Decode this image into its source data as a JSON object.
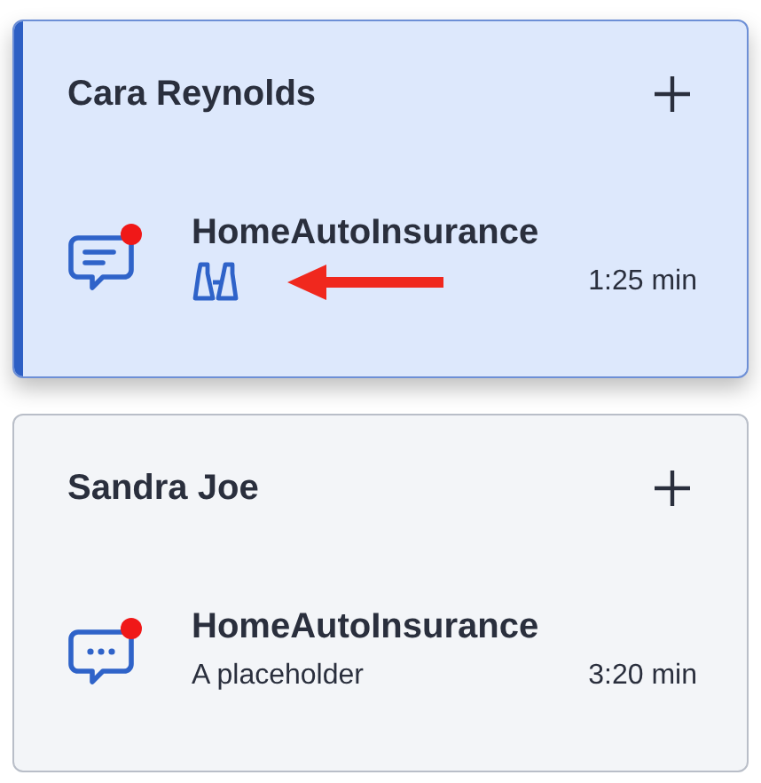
{
  "cards": [
    {
      "name": "Cara Reynolds",
      "selected": true,
      "kind": "watching",
      "unread": true,
      "title": "HomeAutoInsurance",
      "duration": "1:25 min"
    },
    {
      "name": "Sandra Joe",
      "selected": false,
      "kind": "text",
      "unread": true,
      "title": "HomeAutoInsurance",
      "subtitle": "A placeholder",
      "duration": "3:20 min"
    }
  ]
}
